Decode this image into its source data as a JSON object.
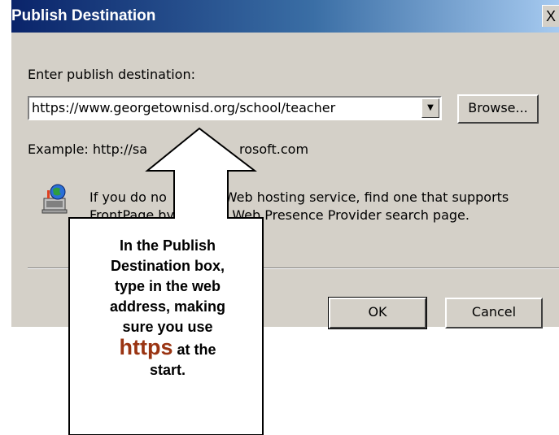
{
  "dialog": {
    "title": "Publish Destination",
    "close_symbol": "X",
    "prompt_label": "Enter publish destination:",
    "destination_value": "https://www.georgetownisd.org/school/teacher",
    "dropdown_arrow": "▼",
    "browse_label": "Browse...",
    "example_text": "Example: http://sa",
    "example_text_tail": "rosoft.com",
    "info_line1_a": "If you do no",
    "info_line1_b": "a Web hosting service, find one that supports",
    "info_line2_a": "FrontPage by",
    "info_line2_b": "the Web Presence Provider search page.",
    "ok_label": "OK",
    "cancel_label": "Cancel"
  },
  "callout": {
    "line1": "In the Publish",
    "line2": "Destination box,",
    "line3": "type in the web",
    "line4": "address, making",
    "line5": "sure you use",
    "highlight": "https",
    "line6_tail": " at the",
    "line7": "start.",
    "highlight_color": "#9a3412"
  }
}
